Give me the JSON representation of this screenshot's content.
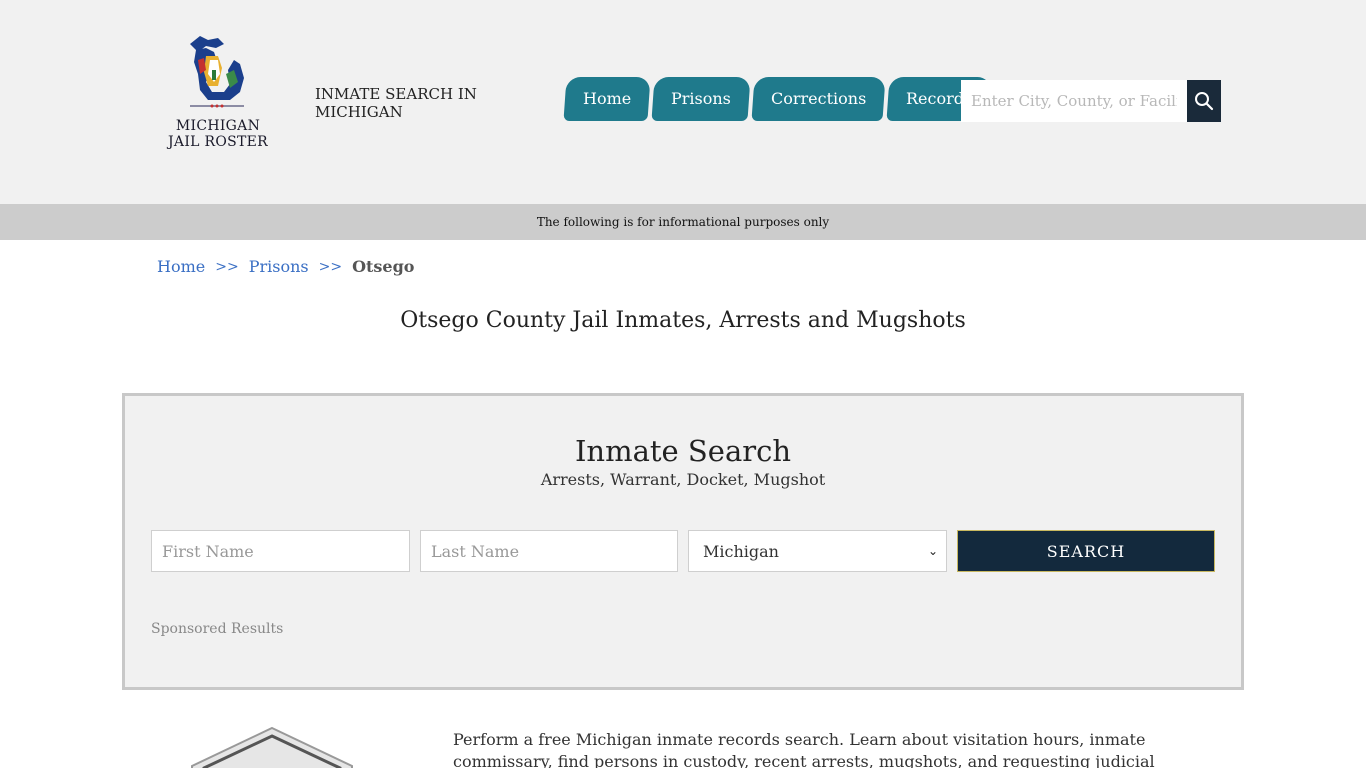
{
  "header": {
    "logo_line1": "MICHIGAN",
    "logo_line2": "JAIL ROSTER",
    "site_title": "INMATE SEARCH IN MICHIGAN",
    "nav": [
      "Home",
      "Prisons",
      "Corrections",
      "Records"
    ],
    "search_placeholder": "Enter City, County, or Facility"
  },
  "info_bar": "The following is for informational purposes only",
  "breadcrumb": {
    "home": "Home",
    "sep": ">>",
    "prisons": "Prisons",
    "current": "Otsego"
  },
  "page_title": "Otsego County Jail Inmates, Arrests and Mugshots",
  "search_panel": {
    "title": "Inmate Search",
    "subtitle": "Arrests, Warrant, Docket, Mugshot",
    "first_placeholder": "First Name",
    "last_placeholder": "Last Name",
    "state_value": "Michigan",
    "submit_label": "SEARCH",
    "sponsored": "Sponsored Results"
  },
  "intro_text": "Perform a free Michigan inmate records search. Learn about visitation hours, inmate commissary, find persons in custody, recent arrests, mugshots, and requesting judicial records.",
  "colors": {
    "nav_bg": "#1f7a8c",
    "search_btn": "#13293d",
    "link": "#3a6fc4",
    "info_bar": "#cccccc"
  }
}
